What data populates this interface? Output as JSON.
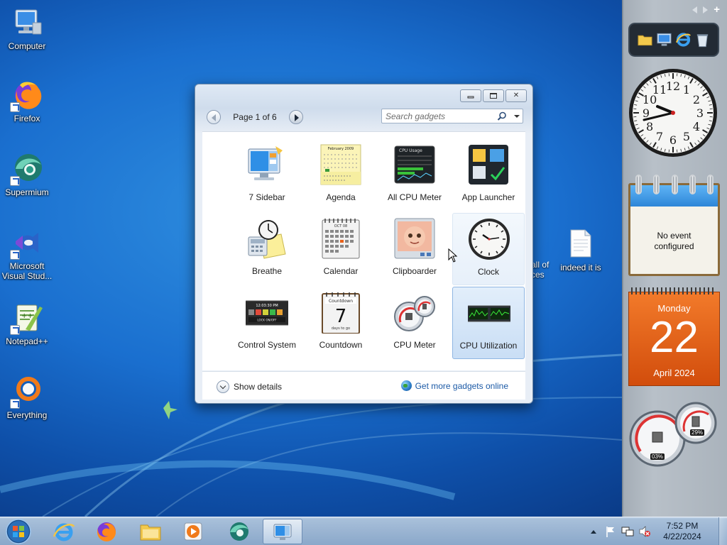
{
  "desktop": {
    "icons": [
      {
        "label": "Computer",
        "icon": "computer-icon"
      },
      {
        "label": "Firefox",
        "icon": "firefox-icon"
      },
      {
        "label": "Supermium",
        "icon": "supermium-icon"
      },
      {
        "label": "Microsoft Visual Stud...",
        "icon": "visual-studio-icon"
      },
      {
        "label": "Notepad++",
        "icon": "notepadpp-icon"
      },
      {
        "label": "Everything",
        "icon": "everything-icon"
      }
    ],
    "right_icons": [
      {
        "label": "indeed it is",
        "icon": "text-file-icon"
      }
    ],
    "partial_text": [
      "all of",
      "ces"
    ]
  },
  "gadget_window": {
    "pager_text": "Page 1 of 6",
    "search_placeholder": "Search gadgets",
    "gadgets": [
      {
        "label": "7 Sidebar",
        "icon": "sidebar-gadget-icon",
        "state": "normal"
      },
      {
        "label": "Agenda",
        "icon": "agenda-gadget-icon",
        "state": "normal"
      },
      {
        "label": "All CPU Meter",
        "icon": "all-cpu-meter-gadget-icon",
        "state": "normal"
      },
      {
        "label": "App Launcher",
        "icon": "app-launcher-gadget-icon",
        "state": "normal"
      },
      {
        "label": "Breathe",
        "icon": "breathe-gadget-icon",
        "state": "normal"
      },
      {
        "label": "Calendar",
        "icon": "calendar-gadget-icon",
        "state": "normal"
      },
      {
        "label": "Clipboarder",
        "icon": "clipboarder-gadget-icon",
        "state": "normal"
      },
      {
        "label": "Clock",
        "icon": "clock-gadget-icon",
        "state": "hover"
      },
      {
        "label": "Control System",
        "icon": "control-system-gadget-icon",
        "state": "normal"
      },
      {
        "label": "Countdown",
        "icon": "countdown-gadget-icon",
        "state": "normal"
      },
      {
        "label": "CPU Meter",
        "icon": "cpu-meter-gadget-icon",
        "state": "normal"
      },
      {
        "label": "CPU Utilization",
        "icon": "cpu-utilization-gadget-icon",
        "state": "selected"
      }
    ],
    "thumb_text": {
      "agenda_title": "February 2009",
      "calendar_month": "OCT 08",
      "countdown_title": "Countdown",
      "countdown_num": "7",
      "countdown_sub": "days to go",
      "cpu_usage_title": "CPU Usage",
      "control_time": "12:03:30 PM",
      "control_lock": "LOCK ON/OFF"
    },
    "show_details": "Show details",
    "more_online": "Get more gadgets online"
  },
  "sidebar": {
    "calendar_note": [
      "No event",
      "configured"
    ],
    "date": {
      "weekday": "Monday",
      "day": "22",
      "month_year": "April 2024"
    },
    "meters": {
      "cpu": "03%",
      "ram": "29%"
    },
    "clock_time": {
      "hour": 9,
      "minute": 42
    }
  },
  "taskbar": {
    "apps": [
      {
        "icon": "internet-explorer-icon",
        "active": false
      },
      {
        "icon": "firefox-icon",
        "active": false
      },
      {
        "icon": "file-explorer-icon",
        "active": false
      },
      {
        "icon": "media-player-icon",
        "active": false
      },
      {
        "icon": "supermium-icon",
        "active": false
      },
      {
        "icon": "gadgets-icon",
        "active": true
      }
    ],
    "clock": {
      "time": "7:52 PM",
      "date": "4/22/2024"
    }
  },
  "colors": {
    "accent_orange": "#e8621a",
    "selection_blue": "#c9def5",
    "link_blue": "#1c5aa6"
  }
}
